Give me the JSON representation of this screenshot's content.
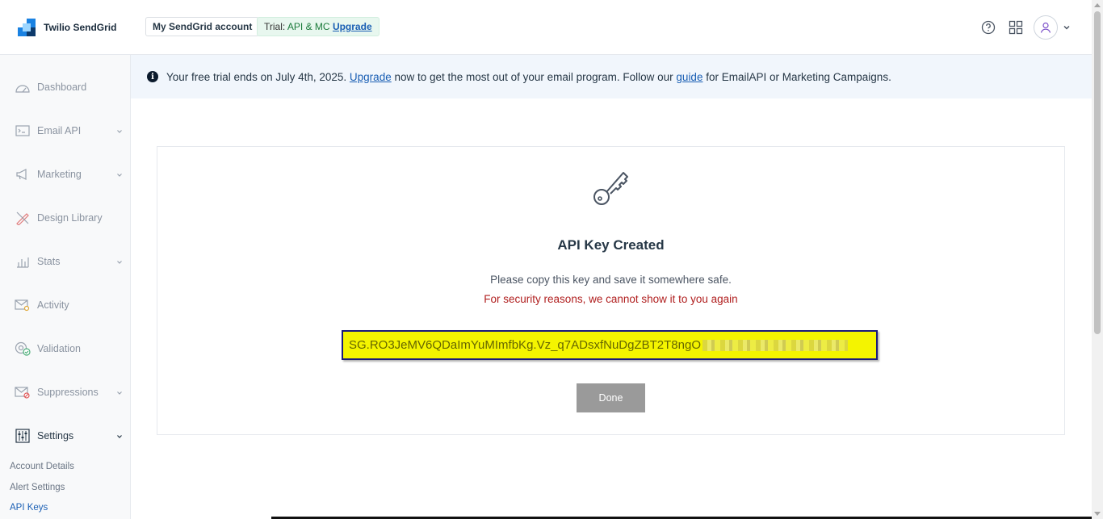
{
  "header": {
    "brand": "Twilio SendGrid",
    "account_button": "My SendGrid account",
    "trial_prefix": "Trial:",
    "trial_plan": "API & MC",
    "trial_upgrade": "Upgrade",
    "icons": [
      "help-icon",
      "apps-grid-icon",
      "user-avatar-icon",
      "chevron-down-icon"
    ]
  },
  "sidebar": {
    "items": [
      {
        "label": "Dashboard",
        "icon": "gauge-icon",
        "has_chevron": false
      },
      {
        "label": "Email API",
        "icon": "terminal-icon",
        "has_chevron": true
      },
      {
        "label": "Marketing",
        "icon": "megaphone-icon",
        "has_chevron": true
      },
      {
        "label": "Design Library",
        "icon": "design-tools-icon",
        "has_chevron": false
      },
      {
        "label": "Stats",
        "icon": "bar-chart-icon",
        "has_chevron": true
      },
      {
        "label": "Activity",
        "icon": "mail-search-icon",
        "has_chevron": false
      },
      {
        "label": "Validation",
        "icon": "at-check-icon",
        "has_chevron": false
      },
      {
        "label": "Suppressions",
        "icon": "mail-blocked-icon",
        "has_chevron": true
      },
      {
        "label": "Settings",
        "icon": "sliders-icon",
        "has_chevron": true
      }
    ],
    "sub_items": [
      "Account Details",
      "Alert Settings",
      "API Keys"
    ]
  },
  "banner": {
    "text_1": "Your free trial ends on July 4th, 2025.",
    "link_upgrade": "Upgrade",
    "text_2": "now to get the most out of your email program. Follow our",
    "link_guide": "guide",
    "text_3": "for EmailAPI or Marketing Campaigns."
  },
  "card": {
    "title": "API Key Created",
    "message": "Please copy this key and save it somewhere safe.",
    "warning": "For security reasons, we cannot show it to you again",
    "api_key_visible": "SG.RO3JeMV6QDaImYuMImfbKg.Vz_q7ADsxfNuDgZBT2T8ngO",
    "done_label": "Done"
  },
  "colors": {
    "accent": "#1a5fb4",
    "warning": "#b01e1e",
    "highlight": "#f4f400",
    "done_button": "#9a9a9a"
  }
}
